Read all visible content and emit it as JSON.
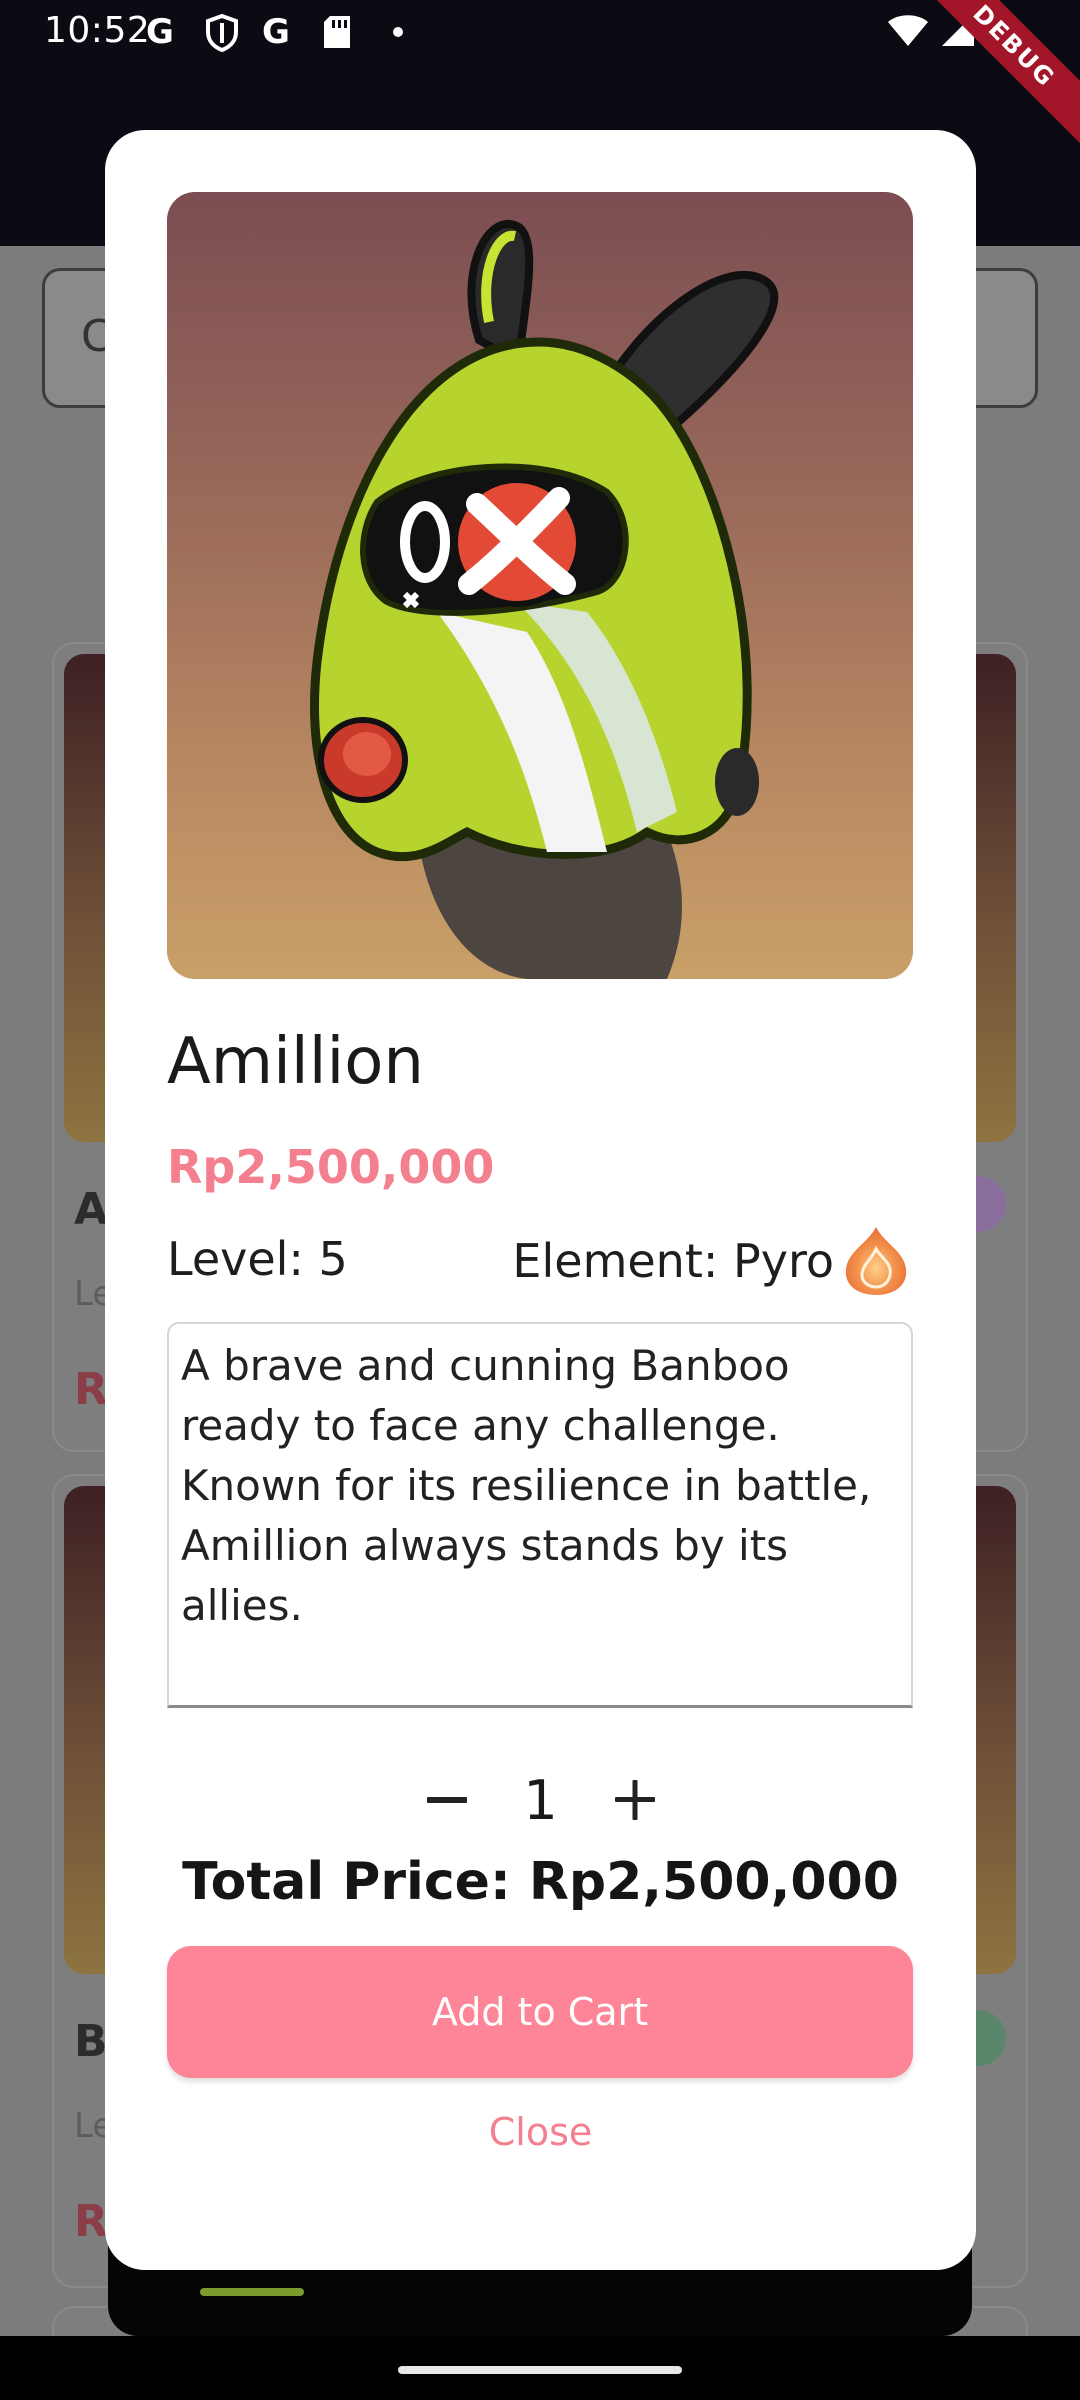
{
  "status_bar": {
    "time": "10:52",
    "icons": [
      "google-g-icon",
      "shield-icon",
      "google-g-icon",
      "sd-card-icon",
      "dot-icon",
      "wifi-icon",
      "signal-icon",
      "battery-icon"
    ],
    "debug_label": "DEBUG"
  },
  "background": {
    "search_letter": "C",
    "cards": [
      {
        "name_initial": "A",
        "sub_initial": "Le",
        "price_initial": "R"
      },
      {
        "name_initial": "Bu",
        "sub_initial": "Le",
        "price_initial": "R"
      }
    ]
  },
  "dialog": {
    "name": "Amillion",
    "price": "Rp2,500,000",
    "level_label": "Level: 5",
    "element_label": "Element: Pyro",
    "element_icon": "pyro-icon",
    "description": "A brave and cunning Banboo ready to face any challenge. Known for its resilience in battle, Amillion always stands by its allies.",
    "quantity": "1",
    "total_price": "Total Price: Rp2,500,000",
    "add_to_cart_label": "Add to Cart",
    "close_label": "Close"
  },
  "colors": {
    "accent": "#fe8597",
    "accent_text": "#f47f8f",
    "status_bar_bg": "#0b0b14",
    "scrim": "#7c7c7c"
  }
}
